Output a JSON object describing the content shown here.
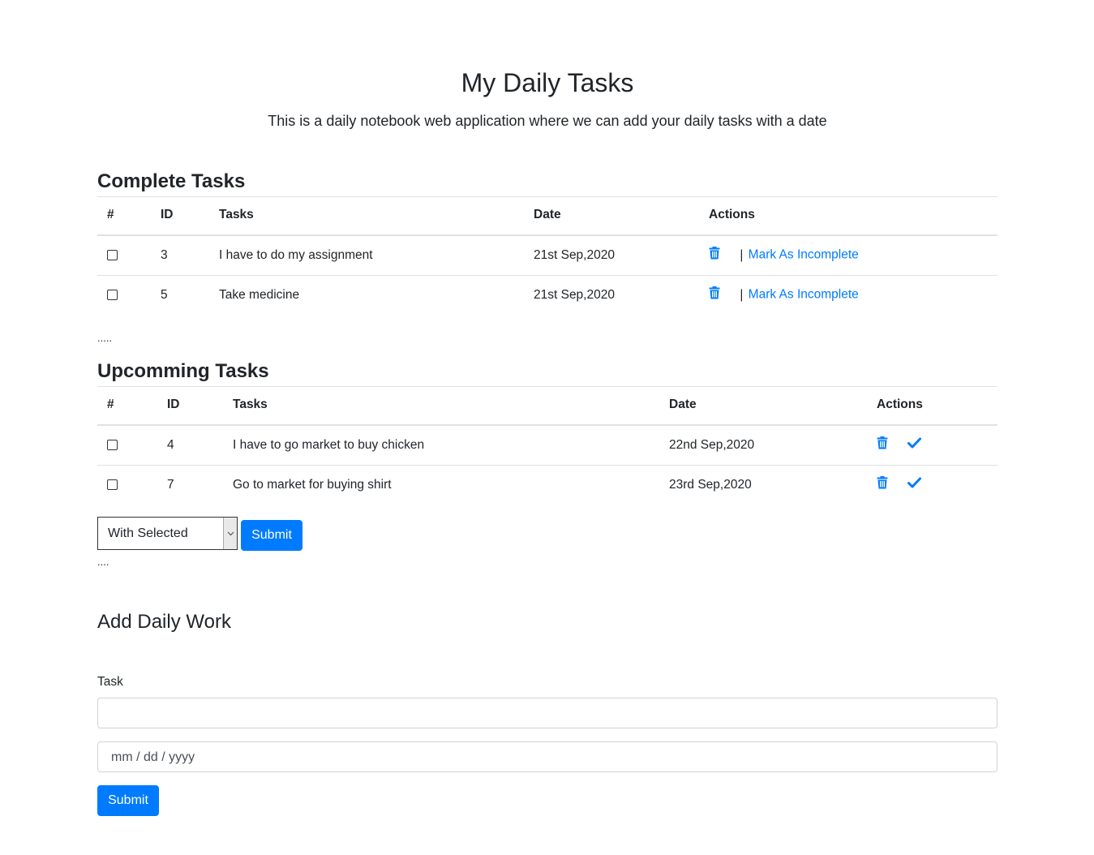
{
  "header": {
    "title": "My Daily Tasks",
    "subtitle": "This is a daily notebook web application where we can add your daily tasks with a date"
  },
  "complete": {
    "title": "Complete Tasks",
    "columns": [
      "#",
      "ID",
      "Tasks",
      "Date",
      "Actions"
    ],
    "rows": [
      {
        "id": "3",
        "task": "I have to do my assignment",
        "date": "21st Sep,2020",
        "separator": "|",
        "action_link": "Mark As Incomplete"
      },
      {
        "id": "5",
        "task": "Take medicine",
        "date": "21st Sep,2020",
        "separator": "|",
        "action_link": "Mark As Incomplete"
      }
    ],
    "dots": "....."
  },
  "upcoming": {
    "title": "Upcomming Tasks",
    "columns": [
      "#",
      "ID",
      "Tasks",
      "Date",
      "Actions"
    ],
    "rows": [
      {
        "id": "4",
        "task": "I have to go market to buy chicken",
        "date": "22nd Sep,2020"
      },
      {
        "id": "7",
        "task": "Go to market for buying shirt",
        "date": "23rd Sep,2020"
      }
    ],
    "bulk": {
      "selected": "With Selected",
      "submit_label": "Submit"
    },
    "dots": "...."
  },
  "form": {
    "title": "Add Daily Work",
    "task_label": "Task",
    "task_value": "",
    "date_placeholder": "mm / dd / yyyy",
    "submit_label": "Submit"
  },
  "colors": {
    "accent": "#007bff",
    "text": "#212529",
    "border": "#dee2e6"
  },
  "icons": {
    "delete": "trash-icon",
    "complete": "check-icon",
    "dropdown": "chevron-down-icon"
  }
}
